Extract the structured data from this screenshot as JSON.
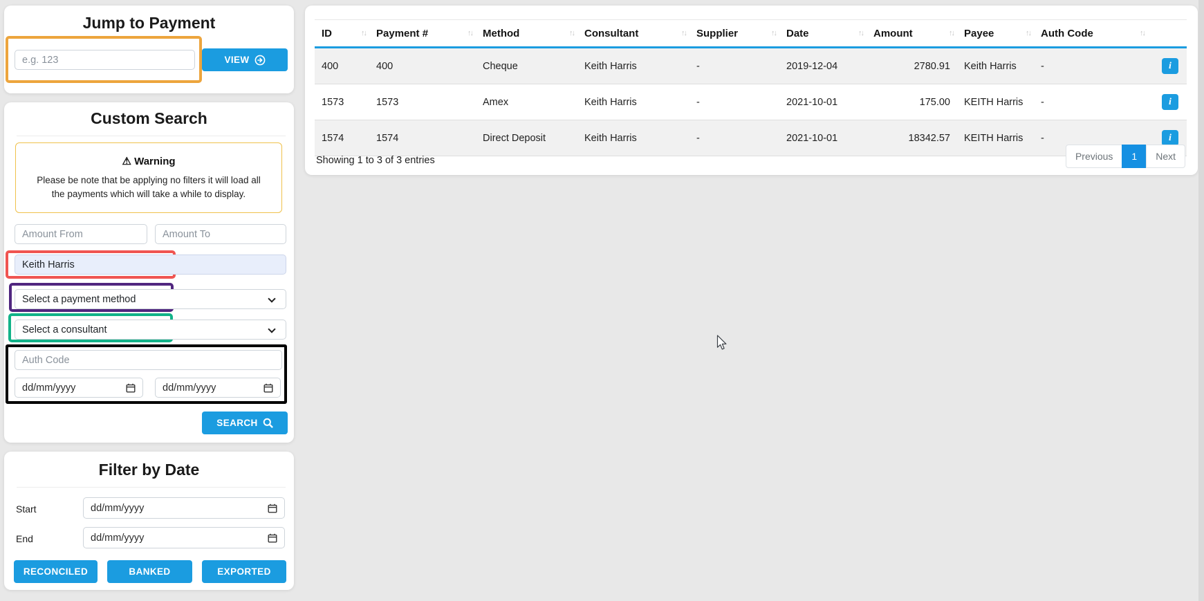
{
  "colors": {
    "accent_blue": "#1b9ce0",
    "warning_border": "#efc14b",
    "highlight_orange": "#eda53d",
    "highlight_red": "#f05551",
    "highlight_purple": "#50267f",
    "highlight_green": "#12b389",
    "highlight_black": "#000000",
    "payee_field_bg": "#e8eefb"
  },
  "icons": {
    "sort": "↑↓",
    "warning": "⚠",
    "info": "i"
  },
  "jump_to_payment": {
    "title": "Jump to Payment",
    "input_placeholder": "e.g. 123",
    "view_button": "VIEW"
  },
  "custom_search": {
    "title": "Custom Search",
    "warning_title": "Warning",
    "warning_text": "Please be note that be applying no filters it will load all the payments which will take a while to display.",
    "amount_from_placeholder": "Amount From",
    "amount_to_placeholder": "Amount To",
    "payee_value": "Keith Harris",
    "payment_method_placeholder": "Select a payment method",
    "consultant_placeholder": "Select a consultant",
    "auth_code_placeholder": "Auth Code",
    "date_from_value": "dd/mm/yyyy",
    "date_to_value": "dd/mm/yyyy",
    "search_button": "SEARCH"
  },
  "filter_by_date": {
    "title": "Filter by Date",
    "start_label": "Start",
    "end_label": "End",
    "start_value": "dd/mm/yyyy",
    "end_value": "dd/mm/yyyy",
    "buttons": [
      "RECONCILED",
      "BANKED",
      "EXPORTED"
    ]
  },
  "table": {
    "columns": [
      "ID",
      "Payment #",
      "Method",
      "Consultant",
      "Supplier",
      "Date",
      "Amount",
      "Payee",
      "Auth Code"
    ],
    "rows": [
      {
        "id": "400",
        "payment": "400",
        "method": "Cheque",
        "consultant": "Keith Harris",
        "supplier": "-",
        "date": "2019-12-04",
        "amount": "2780.91",
        "payee": "Keith Harris",
        "auth": "-"
      },
      {
        "id": "1573",
        "payment": "1573",
        "method": "Amex",
        "consultant": "Keith Harris",
        "supplier": "-",
        "date": "2021-10-01",
        "amount": "175.00",
        "payee": "KEITH Harris",
        "auth": "-"
      },
      {
        "id": "1574",
        "payment": "1574",
        "method": "Direct Deposit",
        "consultant": "Keith Harris",
        "supplier": "-",
        "date": "2021-10-01",
        "amount": "18342.57",
        "payee": "KEITH Harris",
        "auth": "-"
      }
    ],
    "showing_text": "Showing 1 to 3 of 3 entries",
    "pagination": {
      "previous": "Previous",
      "page": "1",
      "next": "Next"
    }
  }
}
